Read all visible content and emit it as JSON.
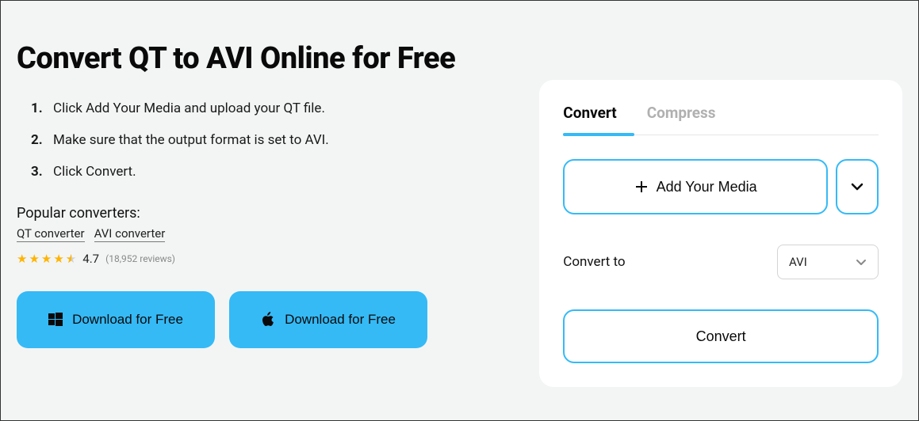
{
  "title": "Convert QT to AVI Online for Free",
  "steps": [
    {
      "n": "1.",
      "text": "Click Add Your Media and upload your QT file."
    },
    {
      "n": "2.",
      "text": "Make sure that the output format is set to AVI."
    },
    {
      "n": "3.",
      "text": "Click Convert."
    }
  ],
  "popular": {
    "label": "Popular converters:",
    "links": [
      "QT converter",
      "AVI converter"
    ]
  },
  "rating": {
    "value": "4.7",
    "count": "(18,952 reviews)"
  },
  "download": {
    "win": "Download for Free",
    "mac": "Download for Free"
  },
  "panel": {
    "tabs": {
      "convert": "Convert",
      "compress": "Compress"
    },
    "add_media": "Add Your Media",
    "convert_to": "Convert to",
    "format": "AVI",
    "convert_button": "Convert"
  }
}
